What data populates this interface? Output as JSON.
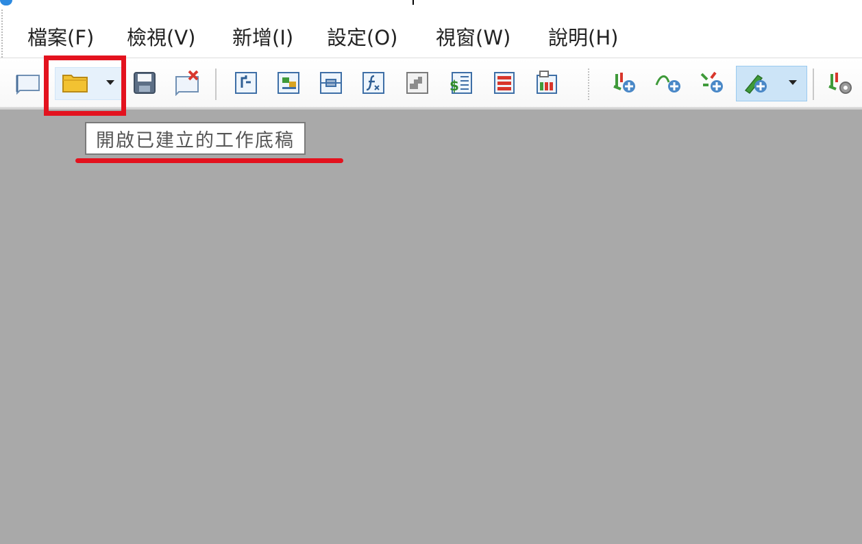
{
  "menu": {
    "items": [
      {
        "label": "檔案(F)"
      },
      {
        "label": "檢視(V)"
      },
      {
        "label": "新增(I)"
      },
      {
        "label": "設定(O)"
      },
      {
        "label": "視窗(W)"
      },
      {
        "label": "說明(H)"
      }
    ]
  },
  "toolbar": {
    "buttons": [
      "new-draft",
      "open-draft",
      "open-draft-dropdown",
      "save-draft",
      "close-draft",
      "add-parameter",
      "add-page",
      "add-link",
      "add-formula",
      "add-module",
      "add-table",
      "add-bar-list",
      "add-data-sheet",
      "add-plus-node",
      "add-curve",
      "add-branch",
      "add-pen-tool",
      "pen-tool-dropdown",
      "settings-node"
    ]
  },
  "tooltip": {
    "text": "開啟已建立的工作底稿"
  },
  "colors": {
    "workspace": "#a9a9a9",
    "annotation_red": "#e3121e",
    "folder_yellow": "#f2c232",
    "active_button": "#cce4f7"
  }
}
